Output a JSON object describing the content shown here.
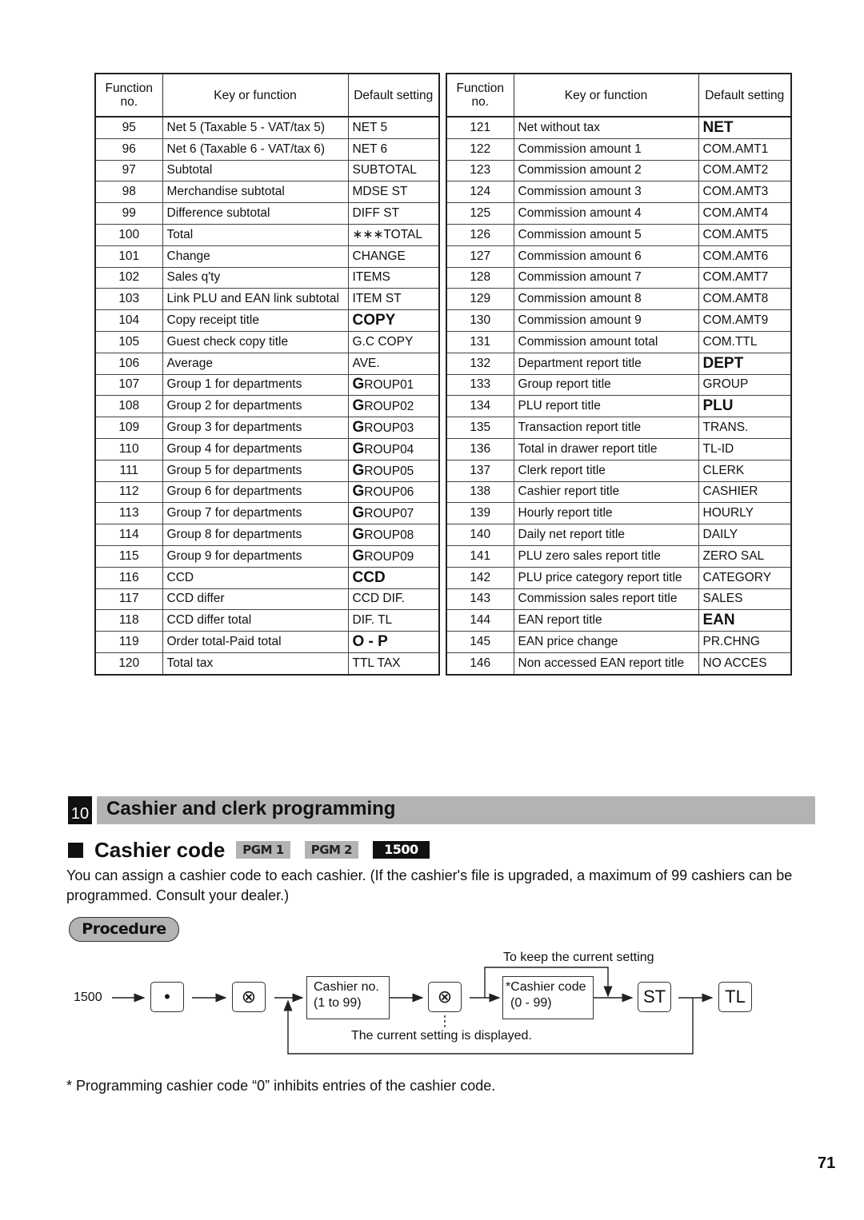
{
  "tables": {
    "headers": {
      "func_no": "Function no.",
      "key": "Key or function",
      "default": "Default setting"
    },
    "left": [
      {
        "no": "95",
        "key": "Net 5 (Taxable 5 - VAT/tax 5)",
        "def": "NET 5",
        "bold": false
      },
      {
        "no": "96",
        "key": "Net 6 (Taxable 6 - VAT/tax 6)",
        "def": "NET 6",
        "bold": false
      },
      {
        "no": "97",
        "key": "Subtotal",
        "def": "SUBTOTAL",
        "bold": false
      },
      {
        "no": "98",
        "key": "Merchandise subtotal",
        "def": "MDSE ST",
        "bold": false
      },
      {
        "no": "99",
        "key": "Difference subtotal",
        "def": "DIFF ST",
        "bold": false
      },
      {
        "no": "100",
        "key": "Total",
        "def": "∗∗∗TOTAL",
        "bold": false
      },
      {
        "no": "101",
        "key": "Change",
        "def": "CHANGE",
        "bold": false
      },
      {
        "no": "102",
        "key": "Sales q'ty",
        "def": "ITEMS",
        "bold": false
      },
      {
        "no": "103",
        "key": "Link PLU and EAN link subtotal",
        "def": "ITEM ST",
        "bold": false
      },
      {
        "no": "104",
        "key": "Copy receipt title",
        "def": "COPY",
        "bold": true
      },
      {
        "no": "105",
        "key": "Guest check copy title",
        "def": "G.C COPY",
        "bold": false
      },
      {
        "no": "106",
        "key": "Average",
        "def": "AVE.",
        "bold": false
      },
      {
        "no": "107",
        "key": "Group 1 for departments",
        "def": "GROUP01",
        "bold": false,
        "first_bold": true
      },
      {
        "no": "108",
        "key": "Group 2 for departments",
        "def": "GROUP02",
        "bold": false,
        "first_bold": true
      },
      {
        "no": "109",
        "key": "Group 3 for departments",
        "def": "GROUP03",
        "bold": false,
        "first_bold": true
      },
      {
        "no": "110",
        "key": "Group 4 for departments",
        "def": "GROUP04",
        "bold": false,
        "first_bold": true
      },
      {
        "no": "111",
        "key": "Group 5 for departments",
        "def": "GROUP05",
        "bold": false,
        "first_bold": true
      },
      {
        "no": "112",
        "key": "Group 6 for departments",
        "def": "GROUP06",
        "bold": false,
        "first_bold": true
      },
      {
        "no": "113",
        "key": "Group 7 for departments",
        "def": "GROUP07",
        "bold": false,
        "first_bold": true
      },
      {
        "no": "114",
        "key": "Group 8 for departments",
        "def": "GROUP08",
        "bold": false,
        "first_bold": true
      },
      {
        "no": "115",
        "key": "Group 9 for departments",
        "def": "GROUP09",
        "bold": false,
        "first_bold": true
      },
      {
        "no": "116",
        "key": "CCD",
        "def": "CCD",
        "bold": true
      },
      {
        "no": "117",
        "key": "CCD differ",
        "def": "CCD DIF.",
        "bold": false
      },
      {
        "no": "118",
        "key": "CCD differ total",
        "def": "DIF. TL",
        "bold": false
      },
      {
        "no": "119",
        "key": "Order total-Paid total",
        "def": "O - P",
        "bold": true
      },
      {
        "no": "120",
        "key": "Total tax",
        "def": "TTL TAX",
        "bold": false
      }
    ],
    "right": [
      {
        "no": "121",
        "key": "Net without tax",
        "def": "NET",
        "bold": true
      },
      {
        "no": "122",
        "key": "Commission amount 1",
        "def": "COM.AMT1",
        "bold": false
      },
      {
        "no": "123",
        "key": "Commission amount 2",
        "def": "COM.AMT2",
        "bold": false
      },
      {
        "no": "124",
        "key": "Commission amount 3",
        "def": "COM.AMT3",
        "bold": false
      },
      {
        "no": "125",
        "key": "Commission amount 4",
        "def": "COM.AMT4",
        "bold": false
      },
      {
        "no": "126",
        "key": "Commission amount 5",
        "def": "COM.AMT5",
        "bold": false
      },
      {
        "no": "127",
        "key": "Commission amount 6",
        "def": "COM.AMT6",
        "bold": false
      },
      {
        "no": "128",
        "key": "Commission amount 7",
        "def": "COM.AMT7",
        "bold": false
      },
      {
        "no": "129",
        "key": "Commission amount 8",
        "def": "COM.AMT8",
        "bold": false
      },
      {
        "no": "130",
        "key": "Commission amount 9",
        "def": "COM.AMT9",
        "bold": false
      },
      {
        "no": "131",
        "key": "Commission amount total",
        "def": "COM.TTL",
        "bold": false
      },
      {
        "no": "132",
        "key": "Department report title",
        "def": "DEPT",
        "bold": true
      },
      {
        "no": "133",
        "key": "Group report title",
        "def": "GROUP",
        "bold": false
      },
      {
        "no": "134",
        "key": "PLU report title",
        "def": "PLU",
        "bold": true
      },
      {
        "no": "135",
        "key": "Transaction report title",
        "def": "TRANS.",
        "bold": false
      },
      {
        "no": "136",
        "key": "Total in drawer report title",
        "def": "TL-ID",
        "bold": false
      },
      {
        "no": "137",
        "key": "Clerk report title",
        "def": "CLERK",
        "bold": false
      },
      {
        "no": "138",
        "key": "Cashier report title",
        "def": "CASHIER",
        "bold": false
      },
      {
        "no": "139",
        "key": "Hourly report title",
        "def": "HOURLY",
        "bold": false
      },
      {
        "no": "140",
        "key": "Daily net report title",
        "def": "DAILY",
        "bold": false
      },
      {
        "no": "141",
        "key": "PLU zero sales report title",
        "def": "ZERO SAL",
        "bold": false
      },
      {
        "no": "142",
        "key": "PLU price category report title",
        "def": "CATEGORY",
        "bold": false
      },
      {
        "no": "143",
        "key": "Commission sales report title",
        "def": "SALES",
        "bold": false
      },
      {
        "no": "144",
        "key": "EAN report title",
        "def": "EAN",
        "bold": true
      },
      {
        "no": "145",
        "key": "EAN price change",
        "def": "PR.CHNG",
        "bold": false
      },
      {
        "no": "146",
        "key": "Non accessed EAN report title",
        "def": "NO ACCES",
        "bold": false
      }
    ]
  },
  "section": {
    "number": "10",
    "title": "Cashier and clerk programming"
  },
  "subsection": {
    "title": "Cashier code",
    "badges": [
      "PGM 1",
      "PGM 2",
      "1500"
    ]
  },
  "body_text": "You can assign a cashier code to each cashier.  (If the cashier's file is upgraded, a maximum of 99 cashiers can be programmed.  Consult your dealer.)",
  "procedure_label": "Procedure",
  "diagram": {
    "start_code": "1500",
    "dot_key": "•",
    "x_key": "⊗",
    "cashier_no_line1": "Cashier no.",
    "cashier_no_line2": "(1 to 99)",
    "cashier_code_line1": "*Cashier code",
    "cashier_code_line2": "(0 - 99)",
    "keep_note": "To keep the current setting",
    "displayed_note": "The current setting is displayed.",
    "st_key": "ST",
    "tl_key": "TL"
  },
  "footnote": "* Programming cashier code “0” inhibits entries of the cashier code.",
  "page_number": "71"
}
